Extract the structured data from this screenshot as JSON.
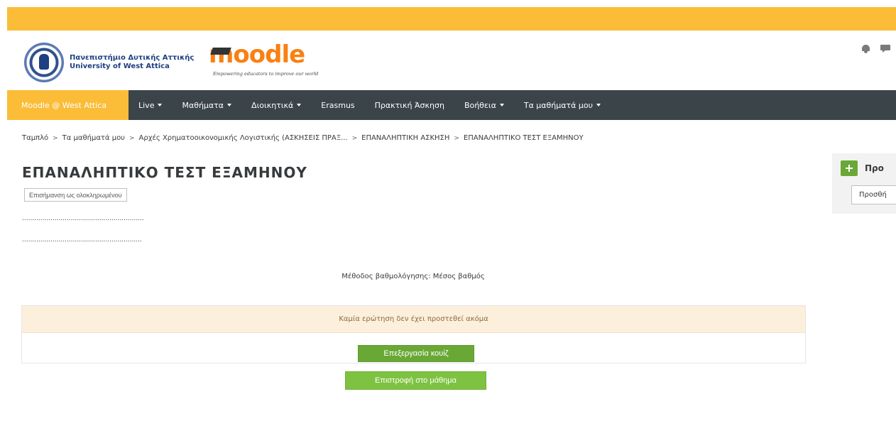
{
  "header": {
    "university_name_gr": "Πανεπιστήμιο Δυτικής Αττικής",
    "university_name_en": "University of West Attica",
    "moodle_word": "moodle",
    "moodle_tagline": "Empowering educators to improve our world",
    "icons": {
      "notifications": "bell-icon",
      "messages": "chat-icon"
    }
  },
  "navbar": {
    "brand": "Moodle @ West Attica",
    "items": [
      {
        "label": "Live",
        "dropdown": true
      },
      {
        "label": "Μαθήματα",
        "dropdown": true
      },
      {
        "label": "Διοικητικά",
        "dropdown": true
      },
      {
        "label": "Erasmus",
        "dropdown": false
      },
      {
        "label": "Πρακτική Άσκηση",
        "dropdown": false
      },
      {
        "label": "Βοήθεια",
        "dropdown": true
      },
      {
        "label": "Τα μαθήματά μου",
        "dropdown": true
      }
    ]
  },
  "breadcrumb": [
    "Ταμπλό",
    "Τα μαθήματά μου",
    "Αρχές Χρηματοοικονομικής Λογιστικής (ΑΣΚΗΣΕΙΣ ΠΡΑΞ...",
    "ΕΠΑΝΑΛΗΠΤΙΚΗ ΑΣΚΗΣΗ",
    "ΕΠΑΝΑΛΗΠΤΙΚΟ ΤΕΣΤ ΕΞΑΜΗΝΟΥ"
  ],
  "main": {
    "title": "ΕΠΑΝΑΛΗΠΤΙΚΟ ΤΕΣΤ ΕΞΑΜΗΝΟΥ",
    "completion_button": "Επισήμανση ως ολοκληρωμένου",
    "dots_line_1": "............................................................",
    "dots_line_2": "...........................................................",
    "grading_method": "Μέθοδος βαθμολόγησης: Μέσος βαθμός",
    "no_questions_notice": "Καμία ερώτηση δεν έχει προστεθεί ακόμα",
    "edit_quiz_button": "Επεξεργασία κουίζ",
    "return_button": "Επιστροφή στο μάθημα"
  },
  "add_block": {
    "title": "Προ",
    "select_value": "Προσθή"
  }
}
